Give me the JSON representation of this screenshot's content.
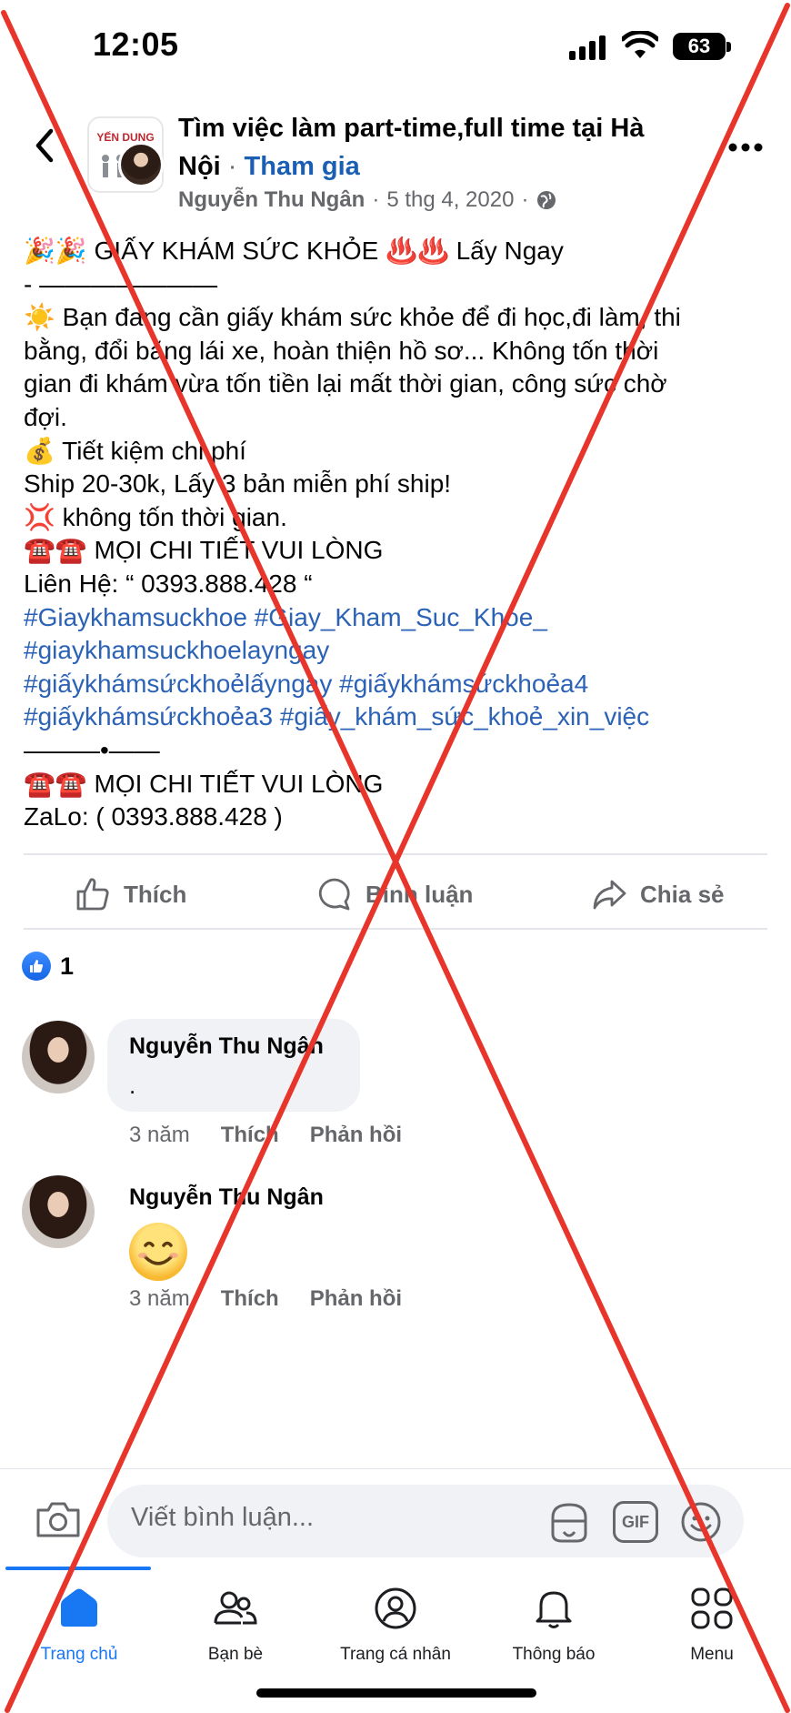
{
  "status_bar": {
    "time": "12:05",
    "battery": "63"
  },
  "header": {
    "group_name": "Tìm việc làm part-time,full time tại Hà Nội",
    "separator": "·",
    "join_label": "Tham gia",
    "group_logo_text": "YẾN DUNG",
    "author": "Nguyễn Thu Ngân",
    "date": "5 thg 4, 2020",
    "meta_separator": "·"
  },
  "post": {
    "lines": [
      {
        "text": "🎉🎉 GIẤY KHÁM SỨC KHỎE ♨️♨️ Lấy Ngay",
        "type": "text"
      },
      {
        "text": "- ———————",
        "type": "text"
      },
      {
        "text": "☀️ Bạn đang cần giấy khám sức khỏe để đi học,đi làm, thi",
        "type": "text"
      },
      {
        "text": "bằng, đổi bằng lái xe, hoàn thiện hồ sơ... Không tốn thời",
        "type": "text"
      },
      {
        "text": "gian đi khám vừa tốn tiền lại mất thời gian, công sức chờ",
        "type": "text"
      },
      {
        "text": "đợi.",
        "type": "text"
      },
      {
        "text": "💰 Tiết kiệm chi phí",
        "type": "text"
      },
      {
        "text": "Ship 20-30k, Lấy 3 bản miễn phí ship!",
        "type": "text"
      },
      {
        "text": "💢 không tốn thời gian.",
        "type": "text"
      },
      {
        "text": "☎️☎️ MỌI CHI TIẾT VUI LÒNG",
        "type": "text"
      },
      {
        "text": "Liên Hệ: “ 0393.888.428 “",
        "type": "text"
      },
      {
        "text": "#Giaykhamsuckhoe #Giay_Kham_Suc_Khoe_",
        "type": "tag"
      },
      {
        "text": "#giaykhamsuckhoelayngay",
        "type": "tag"
      },
      {
        "text": "#giấykhámsứckhoẻlấyngay #giấykhámsứckhoẻa4",
        "type": "tag"
      },
      {
        "text": "#giấykhámsứckhoẻa3 #giấy_khám_sức_khoẻ_xin_việc",
        "type": "tag"
      },
      {
        "text": "———•——",
        "type": "text"
      },
      {
        "text": "☎️☎️ MỌI CHI TIẾT VUI LÒNG",
        "type": "text"
      },
      {
        "text": "ZaLo: ( 0393.888.428 )",
        "type": "text"
      }
    ]
  },
  "actions": {
    "like": "Thích",
    "comment": "Bình luận",
    "share": "Chia sẻ"
  },
  "reactions": {
    "count": "1"
  },
  "comments": [
    {
      "name": "Nguyễn Thu Ngân",
      "text": ".",
      "time": "3 năm",
      "like": "Thích",
      "reply": "Phản hồi"
    },
    {
      "name": "Nguyễn Thu Ngân",
      "text": "😊",
      "time": "3 năm",
      "like": "Thích",
      "reply": "Phản hồi"
    }
  ],
  "comment_input": {
    "placeholder": "Viết bình luận...",
    "gif_label": "GIF"
  },
  "nav": {
    "items": [
      {
        "label": "Trang chủ",
        "icon": "home-icon",
        "active": true
      },
      {
        "label": "Bạn bè",
        "icon": "friends-icon",
        "active": false
      },
      {
        "label": "Trang cá nhân",
        "icon": "profile-icon",
        "active": false
      },
      {
        "label": "Thông báo",
        "icon": "bell-icon",
        "active": false
      },
      {
        "label": "Menu",
        "icon": "menu-icon",
        "active": false
      }
    ]
  },
  "colors": {
    "accent": "#1877f2",
    "hashtag": "#2b62b6",
    "overlay_cross": "#e8352b",
    "secondary_text": "#65676b"
  }
}
